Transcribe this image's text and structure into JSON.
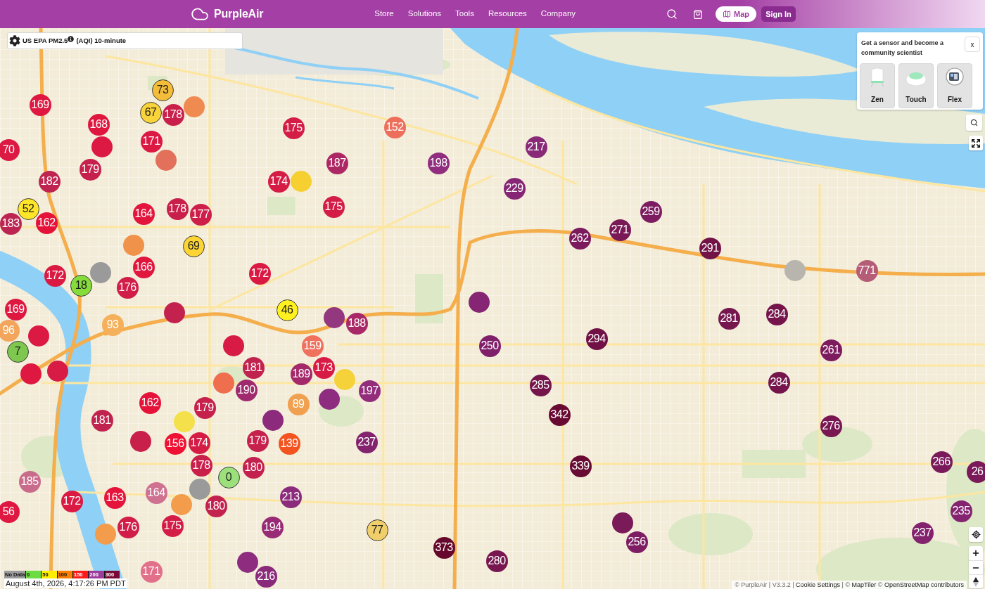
{
  "header": {
    "logo": "PurpleAir",
    "nav": [
      "Store",
      "Solutions",
      "Tools",
      "Resources",
      "Company"
    ],
    "map_button": "Map",
    "sign_in": "Sign In"
  },
  "layer_selector": {
    "label": "US EPA PM2.5",
    "suffix": "(AQI) 10-minute"
  },
  "promo": {
    "text": "Get a sensor and become a community scientist",
    "close": "x",
    "products": [
      {
        "label": "Zen",
        "kind": "tower"
      },
      {
        "label": "Touch",
        "kind": "dome"
      },
      {
        "label": "Flex",
        "kind": "round"
      }
    ]
  },
  "markers": [
    {
      "value": "73",
      "color": "#f3bd3a"
    },
    {
      "value": "169",
      "color": "#de1840"
    },
    {
      "value": "67",
      "color": "#f9d33a"
    },
    {
      "value": "178",
      "color": "#c9204b"
    },
    {
      "color": "#ef8a50"
    },
    {
      "value": "168",
      "color": "#df173f"
    },
    {
      "value": "175",
      "color": "#d31d46"
    },
    {
      "value": "152",
      "color": "#ee6e5c"
    },
    {
      "value": "70",
      "color": "#dc1942"
    },
    {
      "color": "#dc1942"
    },
    {
      "value": "171",
      "color": "#dc1942"
    },
    {
      "value": "217",
      "color": "#892a79"
    },
    {
      "value": "179",
      "color": "#c6214c"
    },
    {
      "color": "#e2705a"
    },
    {
      "value": "187",
      "color": "#ad2764"
    },
    {
      "value": "198",
      "color": "#902d7e"
    },
    {
      "value": "182",
      "color": "#bf2450"
    },
    {
      "value": "174",
      "color": "#d51c45"
    },
    {
      "color": "#f5d030"
    },
    {
      "value": "229",
      "color": "#862674"
    },
    {
      "value": "52",
      "color": "#ffe629"
    },
    {
      "value": "164",
      "color": "#e3153c"
    },
    {
      "value": "178",
      "color": "#c9204b"
    },
    {
      "value": "177",
      "color": "#cd1f49"
    },
    {
      "value": "175",
      "color": "#d31d46"
    },
    {
      "value": "259",
      "color": "#7d1c60"
    },
    {
      "value": "183",
      "color": "#bc2551"
    },
    {
      "value": "162",
      "color": "#e5133a"
    },
    {
      "value": "271",
      "color": "#791956"
    },
    {
      "color": "#f0924a"
    },
    {
      "value": "69",
      "color": "#fcd535"
    },
    {
      "value": "262",
      "color": "#7b1b5d"
    },
    {
      "value": "291",
      "color": "#721247"
    },
    {
      "value": "172",
      "color": "#da1a43"
    },
    {
      "color": "#9a9a9a"
    },
    {
      "value": "166",
      "color": "#e1163d"
    },
    {
      "value": "172",
      "color": "#da1a43"
    },
    {
      "color": "#b8b4ae"
    },
    {
      "value": "771",
      "color": "#b55c77"
    },
    {
      "value": "18",
      "color": "#86dc3b"
    },
    {
      "value": "176",
      "color": "#d01e48"
    },
    {
      "color": "#852574"
    },
    {
      "value": "169",
      "color": "#de1840"
    },
    {
      "color": "#c4224e"
    },
    {
      "value": "46",
      "color": "#fff01f"
    },
    {
      "color": "#93377f"
    },
    {
      "value": "281",
      "color": "#76164f"
    },
    {
      "value": "284",
      "color": "#75154c"
    },
    {
      "value": "93",
      "color": "#f4b05a"
    },
    {
      "value": "188",
      "color": "#a92867"
    },
    {
      "value": "96",
      "color": "#f2a55b"
    },
    {
      "color": "#dc1942"
    },
    {
      "value": "294",
      "color": "#701044"
    },
    {
      "value": "7",
      "color": "#7ec850"
    },
    {
      "color": "#d81b44"
    },
    {
      "value": "159",
      "color": "#ef705d"
    },
    {
      "value": "250",
      "color": "#80206a"
    },
    {
      "value": "261",
      "color": "#7c1b5e"
    },
    {
      "color": "#de1840"
    },
    {
      "color": "#d81b44"
    },
    {
      "value": "181",
      "color": "#c1234f"
    },
    {
      "value": "189",
      "color": "#a4296b"
    },
    {
      "value": "173",
      "color": "#d81b44"
    },
    {
      "color": "#ee6e4e"
    },
    {
      "color": "#f5d23a"
    },
    {
      "value": "285",
      "color": "#74144b"
    },
    {
      "value": "284",
      "color": "#75154c"
    },
    {
      "value": "190",
      "color": "#a02a6e"
    },
    {
      "value": "197",
      "color": "#922c7b"
    },
    {
      "color": "#8e2c80"
    },
    {
      "value": "162",
      "color": "#e5133a"
    },
    {
      "value": "179",
      "color": "#c6214c"
    },
    {
      "value": "89",
      "color": "#f0a04e"
    },
    {
      "value": "342",
      "color": "#690a33"
    },
    {
      "value": "181",
      "color": "#c1234f"
    },
    {
      "color": "#f3e04a"
    },
    {
      "color": "#8c2b7c"
    },
    {
      "value": "276",
      "color": "#781752"
    },
    {
      "color": "#c9204b"
    },
    {
      "value": "156",
      "color": "#ee1133"
    },
    {
      "value": "174",
      "color": "#d51c45"
    },
    {
      "value": "179",
      "color": "#c6214c"
    },
    {
      "value": "139",
      "color": "#f3541f"
    },
    {
      "value": "237",
      "color": "#83236e"
    },
    {
      "value": "266",
      "color": "#7a1a5a"
    },
    {
      "value": "178",
      "color": "#c9204b"
    },
    {
      "value": "180",
      "color": "#c4224e"
    },
    {
      "value": "339",
      "color": "#6a0b34"
    },
    {
      "value": "26",
      "color": "#7a1a5a"
    },
    {
      "value": "0",
      "color": "#9be07a"
    },
    {
      "value": "185",
      "color": "#c96b8b"
    },
    {
      "value": "164",
      "color": "#cf7190"
    },
    {
      "color": "#9a9a9a"
    },
    {
      "value": "172",
      "color": "#da1a43"
    },
    {
      "value": "163",
      "color": "#e5143b"
    },
    {
      "color": "#f29c4c"
    },
    {
      "value": "213",
      "color": "#8c2b7c"
    },
    {
      "value": "56",
      "color": "#de1840"
    },
    {
      "value": "180",
      "color": "#c4224e"
    },
    {
      "value": "235",
      "color": "#842470"
    },
    {
      "color": "#7a1a58"
    },
    {
      "color": "#f29c4c"
    },
    {
      "value": "176",
      "color": "#d01e48"
    },
    {
      "value": "175",
      "color": "#d31d46"
    },
    {
      "value": "194",
      "color": "#982b75"
    },
    {
      "value": "77",
      "color": "#f0cf6a"
    },
    {
      "value": "237",
      "color": "#83236e"
    },
    {
      "value": "256",
      "color": "#7e1d63"
    },
    {
      "value": "373",
      "color": "#66082c"
    },
    {
      "color": "#8e2d80"
    },
    {
      "value": "280",
      "color": "#771650"
    },
    {
      "value": "171",
      "color": "#e2708a"
    },
    {
      "value": "216",
      "color": "#8a2a7a"
    }
  ],
  "legend": [
    {
      "label": "No Data",
      "color": "#9c9c9c"
    },
    {
      "label": "0",
      "color": "#6ddc43"
    },
    {
      "label": "50",
      "color": "#ffee00"
    },
    {
      "label": "100",
      "color": "#ff8000"
    },
    {
      "label": "150",
      "color": "#ff1a1a"
    },
    {
      "label": "200",
      "color": "#9c3c9c"
    },
    {
      "label": "300",
      "color": "#7a0a35"
    }
  ],
  "timestamp": "August 4th, 2026, 4:17:26 PM PDT",
  "attribution": [
    {
      "kind": "text",
      "text": "© PurpleAir | V3.3.2 |"
    },
    {
      "kind": "link",
      "text": "Cookie Settings"
    },
    {
      "kind": "text",
      "text": "| ©"
    },
    {
      "kind": "link",
      "text": "MapTiler"
    },
    {
      "kind": "text",
      "text": "©"
    },
    {
      "kind": "link",
      "text": "OpenStreetMap contributors"
    }
  ]
}
